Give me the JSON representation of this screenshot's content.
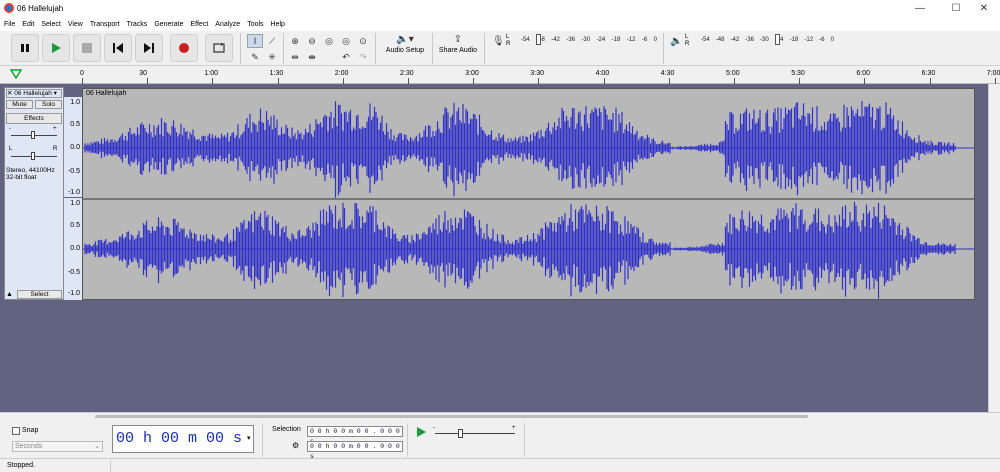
{
  "window": {
    "title": "06 Hallelujah",
    "minimize": "—",
    "maximize": "☐",
    "close": "✕"
  },
  "menu": [
    "File",
    "Edit",
    "Select",
    "View",
    "Transport",
    "Tracks",
    "Generate",
    "Effect",
    "Analyze",
    "Tools",
    "Help"
  ],
  "toolbar": {
    "audio_setup_label": "Audio Setup",
    "share_audio_label": "Share Audio",
    "meter_scale": [
      "-54",
      "-48",
      "-42",
      "-36",
      "-30",
      "-24",
      "-18",
      "-12",
      "-6",
      "0"
    ],
    "playback_scale": [
      "-54",
      "-48",
      "-42",
      "-36",
      "-30",
      "-24",
      "-18",
      "-12",
      "-6",
      "0"
    ],
    "lr": [
      "L",
      "R"
    ]
  },
  "ruler": {
    "ticks": [
      "0",
      "30",
      "1:00",
      "1:30",
      "2:00",
      "2:30",
      "3:00",
      "3:30",
      "4:00",
      "4:30",
      "5:00",
      "5:30",
      "6:00",
      "6:30",
      "7:00"
    ]
  },
  "track": {
    "name": "06 Hallelujah",
    "clip_name": "06 Hallelujah",
    "mute": "Mute",
    "solo": "Solo",
    "effects": "Effects",
    "gain_min": "-",
    "gain_max": "+",
    "pan_left": "L",
    "pan_right": "R",
    "info_line1": "Stereo, 44100Hz",
    "info_line2": "32-bit float",
    "select": "Select",
    "scale": [
      "1.0",
      "0.5",
      "0.0",
      "-0.5",
      "-1.0"
    ]
  },
  "bottom": {
    "snap": "Snap",
    "snap_unit": "Seconds",
    "time": "00 h 00 m 00 s",
    "selection_label": "Selection",
    "sel_start": "0 0 h 0 0 m 0 0 . 0 0 0 s",
    "sel_end": "0 0 h 0 0 m 0 0 . 0 0 0 s",
    "speed_min": "-",
    "speed_max": "+"
  },
  "status": "Stopped.",
  "colors": {
    "waveform": "#3232c8",
    "waveform_rms": "#6464dc",
    "track_bg": "#626380",
    "panel": "#dfe6f6"
  }
}
